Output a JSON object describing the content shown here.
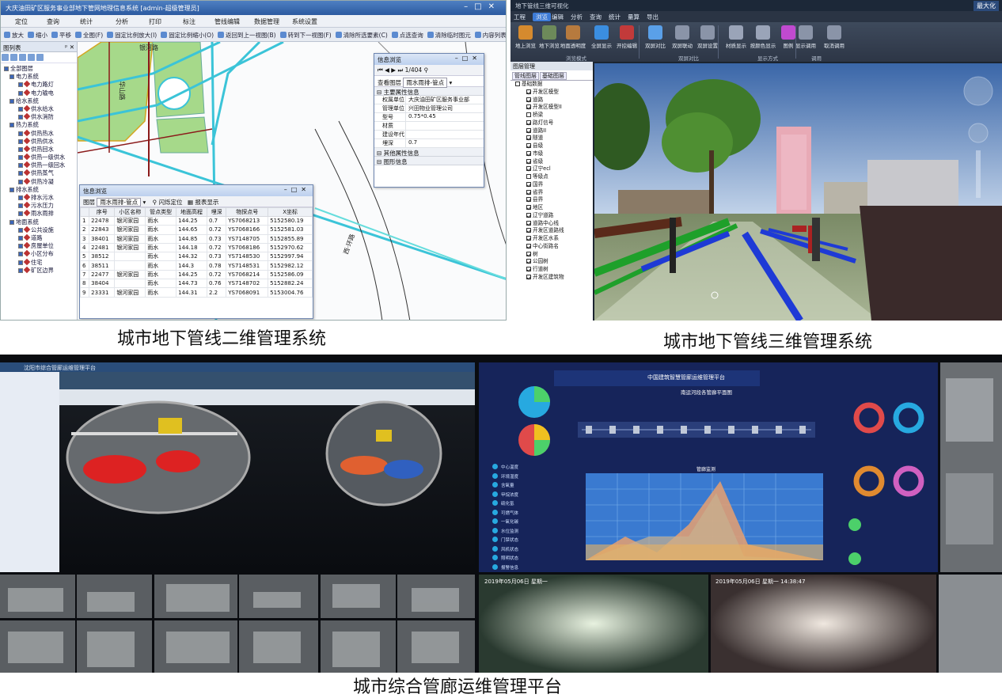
{
  "captions": {
    "two_d": "城市地下管线二维管理系统",
    "three_d": "城市地下管线三维管理系统",
    "platform": "城市综合管廊运维管理平台"
  },
  "sys2d": {
    "window_title": "大庆油田矿区服务事业部地下管网地理信息系统 [admin-超级管理员]",
    "menu": [
      "定位",
      "查询",
      "统计",
      "分析",
      "打印",
      "标注",
      "管线编辑",
      "数据管理",
      "系统设置"
    ],
    "toolbar": [
      "放大",
      "缩小",
      "平移",
      "全图(F)",
      "固定比例放大(I)",
      "固定比例缩小(O)",
      "返回到上一视图(B)",
      "转到下一视图(F)",
      "清除所选要素(C)",
      "点选查询",
      "清除临时图元",
      "内容列表(L)"
    ],
    "layers_header": "图列表",
    "tree": [
      {
        "level": 0,
        "label": "全部图层"
      },
      {
        "level": 1,
        "label": "电力系统"
      },
      {
        "level": 2,
        "label": "电力路灯"
      },
      {
        "level": 2,
        "label": "电力输电"
      },
      {
        "level": 1,
        "label": "给水系统"
      },
      {
        "level": 2,
        "label": "供水给水"
      },
      {
        "level": 2,
        "label": "供水消防"
      },
      {
        "level": 1,
        "label": "热力系统"
      },
      {
        "level": 2,
        "label": "供热热水"
      },
      {
        "level": 2,
        "label": "供热供水"
      },
      {
        "level": 2,
        "label": "供热回水"
      },
      {
        "level": 2,
        "label": "供热一级供水"
      },
      {
        "level": 2,
        "label": "供热一级回水"
      },
      {
        "level": 2,
        "label": "供热蒸气"
      },
      {
        "level": 2,
        "label": "供热冷凝"
      },
      {
        "level": 1,
        "label": "排水系统"
      },
      {
        "level": 2,
        "label": "排水污水"
      },
      {
        "level": 2,
        "label": "污水压力"
      },
      {
        "level": 2,
        "label": "雨水雨排"
      },
      {
        "level": 1,
        "label": "地面系统"
      },
      {
        "level": 2,
        "label": "公共设施"
      },
      {
        "level": 2,
        "label": "道路"
      },
      {
        "level": 2,
        "label": "房屋单位"
      },
      {
        "level": 2,
        "label": "小区分布"
      },
      {
        "level": 2,
        "label": "住宅"
      },
      {
        "level": 2,
        "label": "矿区边界"
      }
    ],
    "map_labels": [
      "银河路",
      "华山路",
      "雨水",
      "西·环路"
    ],
    "info_dialog": {
      "title": "信息浏览",
      "nav": "1/404",
      "layer_label": "查看图层",
      "layer_value": "雨水雨排-管点",
      "section_main": "主要属性信息",
      "props": [
        {
          "k": "权属单位",
          "v": "大庆油田矿区服务事业部"
        },
        {
          "k": "管理单位",
          "v": "兴田物业管理公司"
        },
        {
          "k": "型号",
          "v": "0.75*0.45"
        },
        {
          "k": "材质",
          "v": ""
        },
        {
          "k": "建设年代",
          "v": ""
        },
        {
          "k": "埋深",
          "v": "0.7"
        }
      ],
      "section_other": "其他属性信息",
      "section_graph": "图形信息"
    },
    "list_dialog": {
      "title": "信息浏览",
      "layer_label": "图层",
      "layer_value": "雨水雨排-管点",
      "btn_flash": "闪烁定位",
      "btn_report": "报表显示",
      "columns": [
        "",
        "序号",
        "小区名称",
        "管点类型",
        "地面高程",
        "埋深",
        "物探点号",
        "X坐标"
      ],
      "rows": [
        [
          "1",
          "22478",
          "银河家园",
          "雨水",
          "144.25",
          "0.7",
          "YS7068213",
          "5152580.19"
        ],
        [
          "2",
          "22843",
          "银河家园",
          "雨水",
          "144.65",
          "0.72",
          "YS7068166",
          "5152581.03"
        ],
        [
          "3",
          "38401",
          "银河家园",
          "雨水",
          "144.85",
          "0.73",
          "YS7148705",
          "5152855.89"
        ],
        [
          "4",
          "22481",
          "银河家园",
          "雨水",
          "144.18",
          "0.72",
          "YS7068186",
          "5152970.62"
        ],
        [
          "5",
          "38512",
          "",
          "雨水",
          "144.32",
          "0.73",
          "YS7148530",
          "5152997.94"
        ],
        [
          "6",
          "38511",
          "",
          "雨水",
          "144.3",
          "0.78",
          "YS7148531",
          "5152982.12"
        ],
        [
          "7",
          "22477",
          "银河家园",
          "雨水",
          "144.25",
          "0.72",
          "YS7068214",
          "5152586.09"
        ],
        [
          "8",
          "38404",
          "",
          "雨水",
          "144.73",
          "0.76",
          "YS7148702",
          "5152882.24"
        ],
        [
          "9",
          "23331",
          "银河家园",
          "雨水",
          "144.31",
          "2.2",
          "YS7068091",
          "5153004.76"
        ]
      ]
    }
  },
  "sys3d": {
    "window_title": "地下管线三维可视化",
    "max_button": "最大化",
    "menu": [
      "工程",
      "浏览",
      "编辑",
      "分析",
      "查询",
      "统计",
      "量算",
      "导出"
    ],
    "menu_selected": "浏览",
    "ribbon": [
      {
        "label": "地上浏览",
        "color": "#d58a2e"
      },
      {
        "label": "地下浏览",
        "color": "#6d8a5a"
      },
      {
        "label": "地面透明度",
        "color": "#b67a3e"
      },
      {
        "label": "全屏显示",
        "color": "#3b8ee0"
      },
      {
        "label": "开挖编辑",
        "color": "#c23a3a"
      },
      {
        "label": "双屏对比",
        "color": "#5aa0e8"
      },
      {
        "label": "双屏联动",
        "color": "#8a94a8"
      },
      {
        "label": "双屏设置",
        "color": "#8a94a8"
      },
      {
        "label": "材质显示",
        "color": "#9aa4b8"
      },
      {
        "label": "按颜色显示",
        "color": "#9aa4b8"
      },
      {
        "label": "图例",
        "color": "#c04ad0"
      },
      {
        "label": "显示调用",
        "color": "#8a94a8"
      },
      {
        "label": "取消调用",
        "color": "#8a94a8"
      }
    ],
    "ribbon_groups": [
      "浏览模式",
      "双屏对比",
      "显示方式",
      "调用"
    ],
    "layer_header": "图层管理",
    "layer_tabs": [
      "管线图层",
      "基础图层"
    ],
    "layers": [
      {
        "label": "基础数据",
        "checked": false,
        "root": true
      },
      {
        "label": "开发区模型",
        "checked": true
      },
      {
        "label": "道路",
        "checked": true
      },
      {
        "label": "开发区模型II",
        "checked": true
      },
      {
        "label": "桥梁",
        "checked": false
      },
      {
        "label": "路灯信号",
        "checked": true
      },
      {
        "label": "道路II",
        "checked": true
      },
      {
        "label": "隧道",
        "checked": true
      },
      {
        "label": "县级",
        "checked": true
      },
      {
        "label": "市级",
        "checked": true
      },
      {
        "label": "省级",
        "checked": true
      },
      {
        "label": "辽宁ecl",
        "checked": true
      },
      {
        "label": "等级点",
        "checked": false
      },
      {
        "label": "国界",
        "checked": true
      },
      {
        "label": "省界",
        "checked": true
      },
      {
        "label": "县界",
        "checked": true
      },
      {
        "label": "地区",
        "checked": true
      },
      {
        "label": "辽宁道路",
        "checked": true
      },
      {
        "label": "道路中心线",
        "checked": true
      },
      {
        "label": "开发区道路线",
        "checked": true
      },
      {
        "label": "开发区水系",
        "checked": true
      },
      {
        "label": "中心街路名",
        "checked": true
      },
      {
        "label": "树",
        "checked": true
      },
      {
        "label": "公园树",
        "checked": true
      },
      {
        "label": "行道树",
        "checked": true
      },
      {
        "label": "开发区建筑物",
        "checked": true
      }
    ]
  },
  "ops": {
    "left_title": "沈阳市综合管廊运维管理平台",
    "center_title": "中国建筑智慧管廊运维管理平台",
    "center_subtitle": "南运河段各管廊平面图",
    "chart_label": "管廊监测",
    "left_stats": [
      "中心温度",
      "环境湿度",
      "含氧量",
      "甲烷浓度",
      "硫化氢",
      "可燃气体",
      "一氧化碳",
      "水位监测",
      "门禁状态",
      "风机状态",
      "照明状态",
      "报警信息"
    ],
    "timestamp_a": "2019年05月06日 星期一",
    "timestamp_b": "2019年05月06日 星期一 14:38:47",
    "colors": {
      "bg": "#0c0f14",
      "panel": "#152458",
      "accent": "#1fa3d9"
    }
  }
}
